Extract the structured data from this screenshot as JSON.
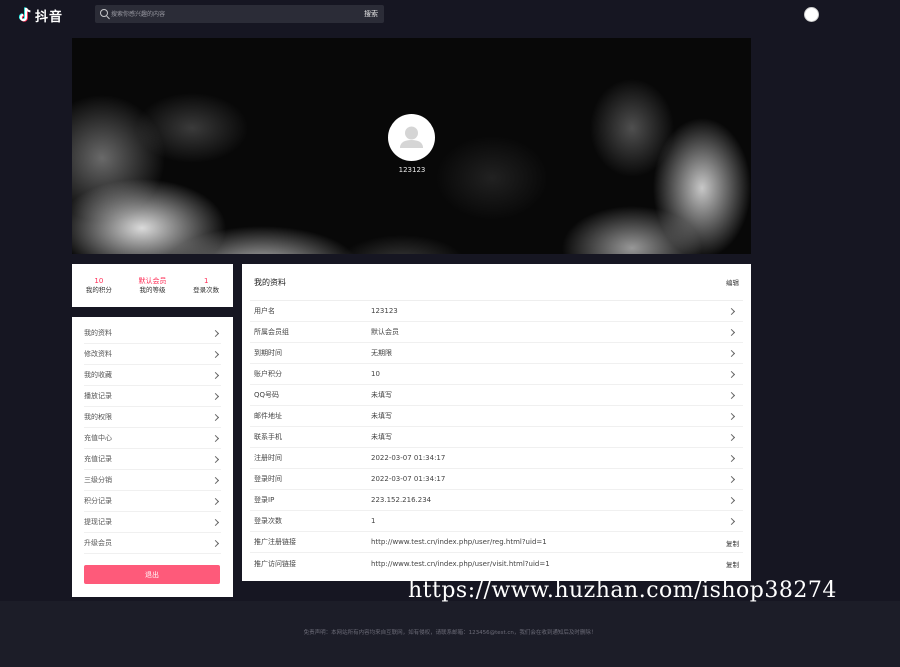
{
  "header": {
    "brand": "抖音",
    "search_placeholder": "搜索你感兴趣的内容",
    "search_button": "搜索"
  },
  "profile": {
    "username": "123123"
  },
  "stats": [
    {
      "value": "10",
      "label": "我的积分"
    },
    {
      "value": "默认会员",
      "label": "我的等级"
    },
    {
      "value": "1",
      "label": "登录次数"
    }
  ],
  "menu": {
    "items": [
      "我的资料",
      "修改资料",
      "我的收藏",
      "播放记录",
      "我的权限",
      "充值中心",
      "充值记录",
      "三级分销",
      "积分记录",
      "提现记录",
      "升级会员"
    ],
    "logout": "退出"
  },
  "main": {
    "title": "我的资料",
    "edit": "编辑",
    "copy": "复制",
    "rows": [
      {
        "label": "用户名",
        "value": "123123"
      },
      {
        "label": "所属会员组",
        "value": "默认会员"
      },
      {
        "label": "到期时间",
        "value": "无期限"
      },
      {
        "label": "账户积分",
        "value": "10"
      },
      {
        "label": "QQ号码",
        "value": "未填写"
      },
      {
        "label": "邮件地址",
        "value": "未填写"
      },
      {
        "label": "联系手机",
        "value": "未填写"
      },
      {
        "label": "注册时间",
        "value": "2022-03-07 01:34:17"
      },
      {
        "label": "登录时间",
        "value": "2022-03-07 01:34:17"
      },
      {
        "label": "登录IP",
        "value": "223.152.216.234"
      },
      {
        "label": "登录次数",
        "value": "1"
      },
      {
        "label": "推广注册链接",
        "value": "http://www.test.cn/index.php/user/reg.html?uid=1"
      },
      {
        "label": "推广访问链接",
        "value": "http://www.test.cn/index.php/user/visit.html?uid=1"
      }
    ]
  },
  "footer": {
    "text": "免责声明：本网站所有内容均来自互联网，如有侵权，请联系邮箱：123456@test.cn，我们会在收到通知后及时删除！"
  },
  "watermark": "https://www.huzhan.com/ishop38274",
  "colors": {
    "accent": "#fe2c55",
    "logout_button": "#fe5a7a",
    "page_bg": "#161622"
  }
}
